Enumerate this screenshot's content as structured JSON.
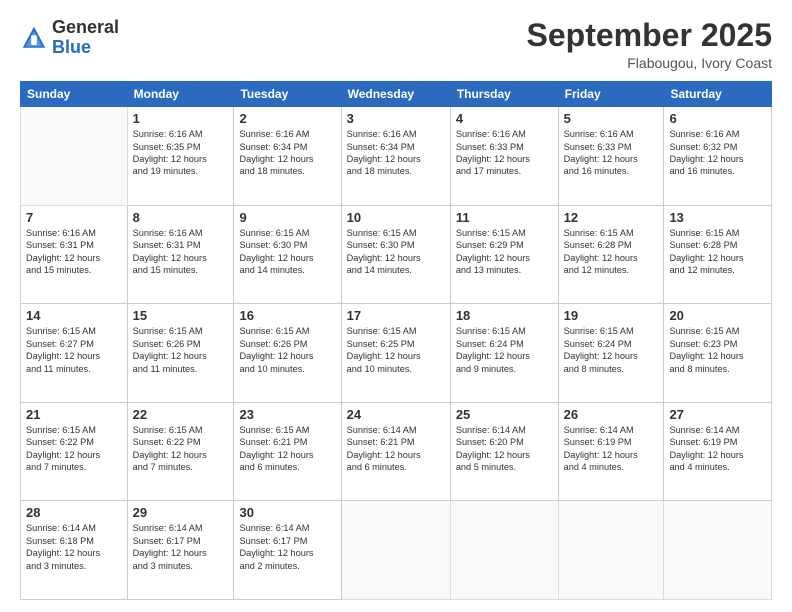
{
  "header": {
    "logo_general": "General",
    "logo_blue": "Blue",
    "month_title": "September 2025",
    "location": "Flabougou, Ivory Coast"
  },
  "days_of_week": [
    "Sunday",
    "Monday",
    "Tuesday",
    "Wednesday",
    "Thursday",
    "Friday",
    "Saturday"
  ],
  "weeks": [
    [
      {
        "day": "",
        "info": ""
      },
      {
        "day": "1",
        "info": "Sunrise: 6:16 AM\nSunset: 6:35 PM\nDaylight: 12 hours\nand 19 minutes."
      },
      {
        "day": "2",
        "info": "Sunrise: 6:16 AM\nSunset: 6:34 PM\nDaylight: 12 hours\nand 18 minutes."
      },
      {
        "day": "3",
        "info": "Sunrise: 6:16 AM\nSunset: 6:34 PM\nDaylight: 12 hours\nand 18 minutes."
      },
      {
        "day": "4",
        "info": "Sunrise: 6:16 AM\nSunset: 6:33 PM\nDaylight: 12 hours\nand 17 minutes."
      },
      {
        "day": "5",
        "info": "Sunrise: 6:16 AM\nSunset: 6:33 PM\nDaylight: 12 hours\nand 16 minutes."
      },
      {
        "day": "6",
        "info": "Sunrise: 6:16 AM\nSunset: 6:32 PM\nDaylight: 12 hours\nand 16 minutes."
      }
    ],
    [
      {
        "day": "7",
        "info": "Sunrise: 6:16 AM\nSunset: 6:31 PM\nDaylight: 12 hours\nand 15 minutes."
      },
      {
        "day": "8",
        "info": "Sunrise: 6:16 AM\nSunset: 6:31 PM\nDaylight: 12 hours\nand 15 minutes."
      },
      {
        "day": "9",
        "info": "Sunrise: 6:15 AM\nSunset: 6:30 PM\nDaylight: 12 hours\nand 14 minutes."
      },
      {
        "day": "10",
        "info": "Sunrise: 6:15 AM\nSunset: 6:30 PM\nDaylight: 12 hours\nand 14 minutes."
      },
      {
        "day": "11",
        "info": "Sunrise: 6:15 AM\nSunset: 6:29 PM\nDaylight: 12 hours\nand 13 minutes."
      },
      {
        "day": "12",
        "info": "Sunrise: 6:15 AM\nSunset: 6:28 PM\nDaylight: 12 hours\nand 12 minutes."
      },
      {
        "day": "13",
        "info": "Sunrise: 6:15 AM\nSunset: 6:28 PM\nDaylight: 12 hours\nand 12 minutes."
      }
    ],
    [
      {
        "day": "14",
        "info": "Sunrise: 6:15 AM\nSunset: 6:27 PM\nDaylight: 12 hours\nand 11 minutes."
      },
      {
        "day": "15",
        "info": "Sunrise: 6:15 AM\nSunset: 6:26 PM\nDaylight: 12 hours\nand 11 minutes."
      },
      {
        "day": "16",
        "info": "Sunrise: 6:15 AM\nSunset: 6:26 PM\nDaylight: 12 hours\nand 10 minutes."
      },
      {
        "day": "17",
        "info": "Sunrise: 6:15 AM\nSunset: 6:25 PM\nDaylight: 12 hours\nand 10 minutes."
      },
      {
        "day": "18",
        "info": "Sunrise: 6:15 AM\nSunset: 6:24 PM\nDaylight: 12 hours\nand 9 minutes."
      },
      {
        "day": "19",
        "info": "Sunrise: 6:15 AM\nSunset: 6:24 PM\nDaylight: 12 hours\nand 8 minutes."
      },
      {
        "day": "20",
        "info": "Sunrise: 6:15 AM\nSunset: 6:23 PM\nDaylight: 12 hours\nand 8 minutes."
      }
    ],
    [
      {
        "day": "21",
        "info": "Sunrise: 6:15 AM\nSunset: 6:22 PM\nDaylight: 12 hours\nand 7 minutes."
      },
      {
        "day": "22",
        "info": "Sunrise: 6:15 AM\nSunset: 6:22 PM\nDaylight: 12 hours\nand 7 minutes."
      },
      {
        "day": "23",
        "info": "Sunrise: 6:15 AM\nSunset: 6:21 PM\nDaylight: 12 hours\nand 6 minutes."
      },
      {
        "day": "24",
        "info": "Sunrise: 6:14 AM\nSunset: 6:21 PM\nDaylight: 12 hours\nand 6 minutes."
      },
      {
        "day": "25",
        "info": "Sunrise: 6:14 AM\nSunset: 6:20 PM\nDaylight: 12 hours\nand 5 minutes."
      },
      {
        "day": "26",
        "info": "Sunrise: 6:14 AM\nSunset: 6:19 PM\nDaylight: 12 hours\nand 4 minutes."
      },
      {
        "day": "27",
        "info": "Sunrise: 6:14 AM\nSunset: 6:19 PM\nDaylight: 12 hours\nand 4 minutes."
      }
    ],
    [
      {
        "day": "28",
        "info": "Sunrise: 6:14 AM\nSunset: 6:18 PM\nDaylight: 12 hours\nand 3 minutes."
      },
      {
        "day": "29",
        "info": "Sunrise: 6:14 AM\nSunset: 6:17 PM\nDaylight: 12 hours\nand 3 minutes."
      },
      {
        "day": "30",
        "info": "Sunrise: 6:14 AM\nSunset: 6:17 PM\nDaylight: 12 hours\nand 2 minutes."
      },
      {
        "day": "",
        "info": ""
      },
      {
        "day": "",
        "info": ""
      },
      {
        "day": "",
        "info": ""
      },
      {
        "day": "",
        "info": ""
      }
    ]
  ]
}
